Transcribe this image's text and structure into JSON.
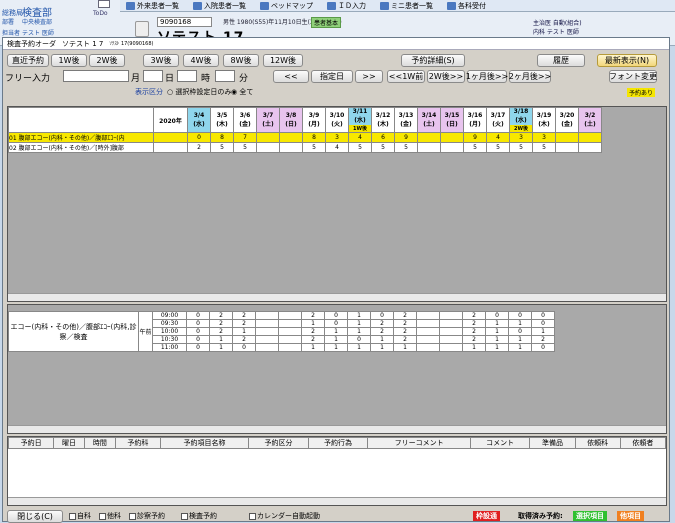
{
  "bgapp": {
    "dept_label": "総務局",
    "dept_value": "検査部",
    "sub_label": "部署",
    "sub_value": "中央検査部",
    "user_label": "担当者",
    "user_value": "テスト 医師",
    "todo": "ToDo",
    "topbar": [
      "外来患者一覧",
      "入院患者一覧",
      "ベッドマップ",
      "ＩＤ入力",
      "ミニ患者一覧",
      "各科受付"
    ]
  },
  "patient": {
    "id": "9090168",
    "name": "ソテスト 17",
    "info": "男性 1980(S55)年11月10日生(39歳3ヶ月)",
    "badge": "患者基本",
    "doctor": "主治医 自動(組合)",
    "doctor2": "内科 テスト 医師"
  },
  "window": {
    "title": "検査予約オーダ",
    "title_patient": "ソテスト 1 7",
    "title_id": "ｿﾃｽﾄ 17(9090168)"
  },
  "toolbar": {
    "recent": "直近予約",
    "w1": "1W後",
    "w2": "2W後",
    "w3": "3W後",
    "w4": "4W後",
    "w8": "8W後",
    "w12": "12W後",
    "detail": "予約詳細(S)",
    "history": "履歴",
    "refresh": "最新表示(N)",
    "free_label": "フリー入力",
    "month": "月",
    "day": "日",
    "hour": "時",
    "minute": "分",
    "prev": "<<",
    "date_btn": "指定日",
    "next": ">>",
    "p1w": "<<1W前",
    "p2w": "2W後>>",
    "p1m": "1ヶ月後>>",
    "p2m": "2ヶ月後>>",
    "font": "フォント変更",
    "disp_label": "表示区分",
    "opt1": "選択枠設定日のみ",
    "opt2": "全て",
    "reserved": "予約あり"
  },
  "calendar": {
    "year": "2020年",
    "dates": [
      {
        "d": "3/4",
        "w": "(水)",
        "t": "today"
      },
      {
        "d": "3/5",
        "w": "(木)",
        "t": ""
      },
      {
        "d": "3/6",
        "w": "(金)",
        "t": ""
      },
      {
        "d": "3/7",
        "w": "(土)",
        "t": "sat"
      },
      {
        "d": "3/8",
        "w": "(日)",
        "t": "sun"
      },
      {
        "d": "3/9",
        "w": "(月)",
        "t": ""
      },
      {
        "d": "3/10",
        "w": "(火)",
        "t": ""
      },
      {
        "d": "3/11",
        "w": "(水)",
        "t": "today",
        "tag": "1W後"
      },
      {
        "d": "3/12",
        "w": "(木)",
        "t": ""
      },
      {
        "d": "3/13",
        "w": "(金)",
        "t": ""
      },
      {
        "d": "3/14",
        "w": "(土)",
        "t": "sat"
      },
      {
        "d": "3/15",
        "w": "(日)",
        "t": "sun"
      },
      {
        "d": "3/16",
        "w": "(月)",
        "t": ""
      },
      {
        "d": "3/17",
        "w": "(火)",
        "t": ""
      },
      {
        "d": "3/18",
        "w": "(水)",
        "t": "today",
        "tag": "2W後"
      },
      {
        "d": "3/19",
        "w": "(木)",
        "t": ""
      },
      {
        "d": "3/20",
        "w": "(金)",
        "t": ""
      },
      {
        "d": "3/2",
        "w": "(土)",
        "t": "sat"
      }
    ],
    "rows": [
      {
        "name": "01 腹部エコー(内科・その他)／腹部ｴｺｰ(内",
        "vals": [
          "0",
          "8",
          "7",
          "",
          "",
          "8",
          "3",
          "4",
          "6",
          "9",
          "",
          "",
          "9",
          "4",
          "3",
          "3",
          "",
          ""
        ]
      },
      {
        "name": "02 腹部エコー(内科・その他)／[時外]腹部",
        "vals": [
          "2",
          "5",
          "5",
          "",
          "",
          "5",
          "4",
          "5",
          "5",
          "5",
          "",
          "",
          "5",
          "5",
          "5",
          "5",
          "",
          ""
        ]
      }
    ]
  },
  "timeslots": {
    "label": "エコー(内科・その他)／腹部ｴｺｰ(内科,診察／検査",
    "ampm": "午前",
    "rows": [
      {
        "t": "09:00",
        "vals": [
          "0",
          "2",
          "2",
          "",
          "",
          "2",
          "0",
          "1",
          "0",
          "2",
          "",
          "",
          "2",
          "0",
          "0",
          "0"
        ]
      },
      {
        "t": "09:30",
        "vals": [
          "0",
          "2",
          "2",
          "",
          "",
          "1",
          "0",
          "1",
          "2",
          "2",
          "",
          "",
          "2",
          "1",
          "1",
          "0"
        ]
      },
      {
        "t": "10:00",
        "vals": [
          "0",
          "2",
          "1",
          "",
          "",
          "2",
          "1",
          "1",
          "2",
          "2",
          "",
          "",
          "2",
          "1",
          "0",
          "1"
        ]
      },
      {
        "t": "10:30",
        "vals": [
          "0",
          "1",
          "2",
          "",
          "",
          "2",
          "1",
          "0",
          "1",
          "2",
          "",
          "",
          "2",
          "1",
          "1",
          "2"
        ]
      },
      {
        "t": "11:00",
        "vals": [
          "0",
          "1",
          "0",
          "",
          "",
          "1",
          "1",
          "1",
          "1",
          "1",
          "",
          "",
          "1",
          "1",
          "1",
          "0"
        ]
      }
    ]
  },
  "list": {
    "columns": [
      "予約日",
      "曜日",
      "時間",
      "予約科",
      "予約項目名称",
      "予約区分",
      "予約行為",
      "フリーコメント",
      "コメント",
      "準備品",
      "依頼科",
      "依頼者"
    ]
  },
  "bottom": {
    "close": "閉じる(C)",
    "checks": [
      "自科",
      "他科",
      "診察予約",
      "検査予約"
    ],
    "calendar_check": "カレンダー自動起動",
    "legend_red": "枠設通",
    "legend_text": "取得済み予約:",
    "legend_green": "選択項目",
    "legend_orange": "他項目"
  },
  "colors": {
    "today": "#8fd6ec",
    "weekend": "#e8c4ee",
    "highlight": "#f5e600",
    "legend_red": "#e02020",
    "legend_green": "#30c030",
    "legend_orange": "#f08020"
  }
}
